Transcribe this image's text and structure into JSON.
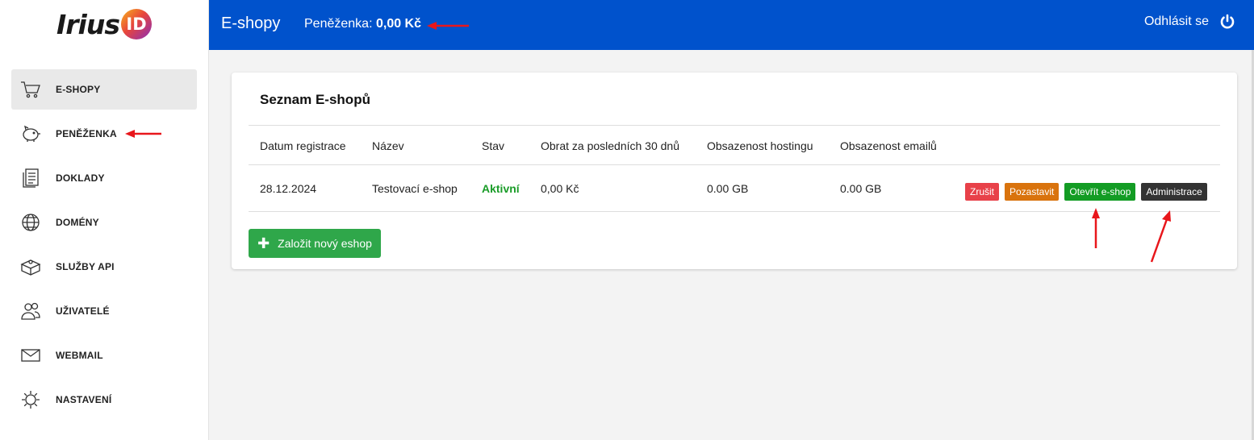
{
  "brand": {
    "logo_text": "Irius",
    "logo_badge": "ID"
  },
  "sidebar": {
    "items": [
      {
        "label": "E-SHOPY",
        "icon": "cart-icon",
        "active": true
      },
      {
        "label": "PENĚŽENKA",
        "icon": "piggy-bank-icon"
      },
      {
        "label": "DOKLADY",
        "icon": "document-icon"
      },
      {
        "label": "DOMÉNY",
        "icon": "globe-icon"
      },
      {
        "label": "SLUŽBY API",
        "icon": "api-box-icon"
      },
      {
        "label": "UŽIVATELÉ",
        "icon": "users-icon"
      },
      {
        "label": "WEBMAIL",
        "icon": "envelope-icon"
      },
      {
        "label": "NASTAVENÍ",
        "icon": "gear-icon"
      }
    ]
  },
  "header": {
    "title": "E-shopy",
    "wallet_label": "Peněženka:",
    "wallet_value": "0,00 Kč",
    "logout_label": "Odhlásit se",
    "logout_icon": "power-icon",
    "bg_color": "#0052cc"
  },
  "card": {
    "title": "Seznam E-shopů",
    "columns": [
      "Datum registrace",
      "Název",
      "Stav",
      "Obrat za posledních 30 dnů",
      "Obsazenost hostingu",
      "Obsazenost emailů"
    ],
    "rows": [
      {
        "date": "28.12.2024",
        "name": "Testovací e-shop",
        "status": "Aktivní",
        "turnover": "0,00 Kč",
        "hosting": "0.00 GB",
        "email": "0.00 GB",
        "actions": {
          "cancel": "Zrušit",
          "pause": "Pozastavit",
          "open": "Otevřít e-shop",
          "admin": "Administrace"
        }
      }
    ],
    "new_button": "Založit nový eshop"
  },
  "colors": {
    "status_active": "#1a9c28",
    "btn_cancel": "#e84149",
    "btn_pause": "#d9730d",
    "btn_open": "#139c24",
    "btn_admin": "#333333",
    "btn_new": "#2fa74a",
    "annotation_arrow": "#e8161b"
  }
}
